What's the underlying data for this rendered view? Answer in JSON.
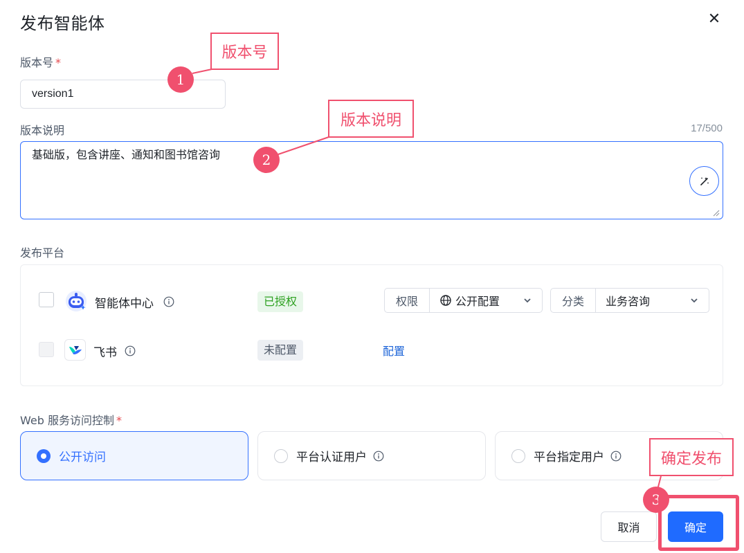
{
  "dialog": {
    "title": "发布智能体",
    "close_icon": "close-icon"
  },
  "version": {
    "label": "版本号",
    "required_mark": "*",
    "value": "version1"
  },
  "description": {
    "label": "版本说明",
    "counter": "17/500",
    "value": "基础版，包含讲座、通知和图书馆咨询",
    "magic_icon": "magic-wand-icon"
  },
  "platforms": {
    "label": "发布平台",
    "items": [
      {
        "name": "智能体中心",
        "icon": "agent-center-logo",
        "status": "已授权",
        "permission_label": "权限",
        "permission_value": "公开配置",
        "category_label": "分类",
        "category_value": "业务咨询"
      },
      {
        "name": "飞书",
        "icon": "feishu-logo",
        "status": "未配置",
        "action": "配置"
      }
    ]
  },
  "web_access": {
    "label": "Web 服务访问控制",
    "required_mark": "*",
    "options": [
      {
        "label": "公开访问",
        "selected": true
      },
      {
        "label": "平台认证用户",
        "selected": false
      },
      {
        "label": "平台指定用户",
        "selected": false
      }
    ]
  },
  "footer": {
    "cancel_label": "取消",
    "confirm_label": "确定"
  },
  "annotations": [
    {
      "number": "1",
      "text": "版本号"
    },
    {
      "number": "2",
      "text": "版本说明"
    },
    {
      "number": "3",
      "text": "确定发布"
    }
  ],
  "colors": {
    "primary": "#3370ff",
    "confirm_button": "#1f6bff",
    "annotation": "#f0506e",
    "authorized_tag": "#2ea121"
  }
}
